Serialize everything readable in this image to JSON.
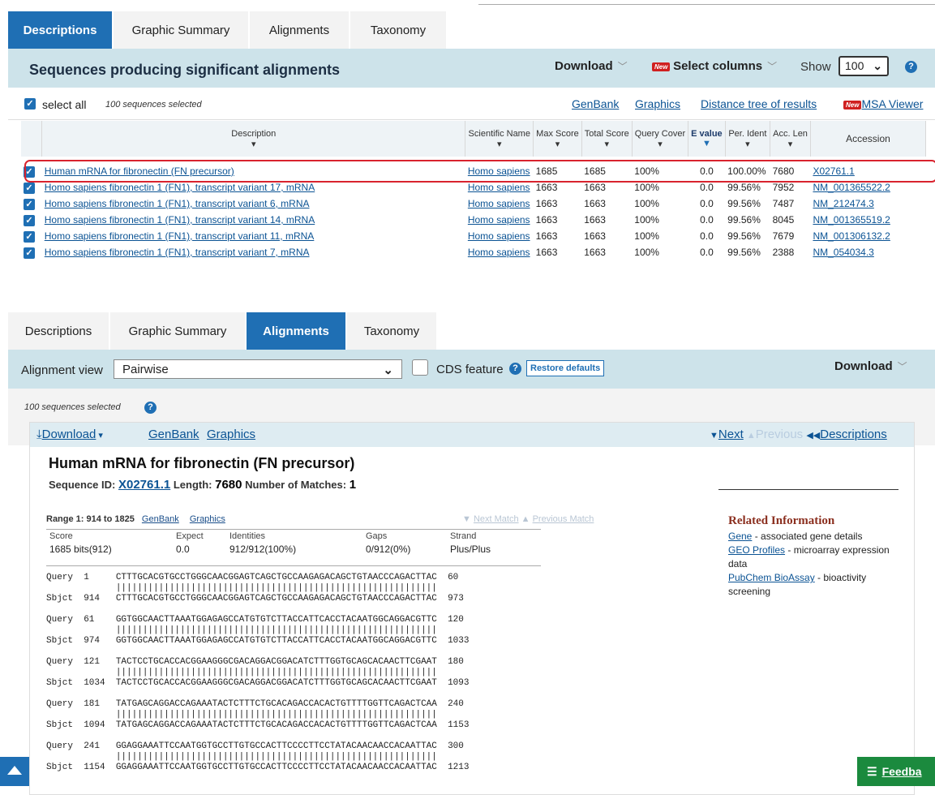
{
  "top": {
    "tabs": [
      "Descriptions",
      "Graphic Summary",
      "Alignments",
      "Taxonomy"
    ],
    "header_title": "Sequences producing significant alignments",
    "download_label": "Download",
    "new_badge": "New",
    "select_columns_label": "Select columns",
    "show_label": "Show",
    "show_value": "100",
    "select_all_label": "select all",
    "selected_count": "100 sequences selected",
    "links": [
      "GenBank",
      "Graphics",
      "Distance tree of results",
      "MSA Viewer"
    ],
    "columns": [
      "Description",
      "Scientific Name",
      "Max Score",
      "Total Score",
      "Query Cover",
      "E value",
      "Per. Ident",
      "Acc. Len",
      "Accession"
    ],
    "rows": [
      {
        "description": "Human mRNA for fibronectin (FN precursor)",
        "sci": "Homo sapiens",
        "max": "1685",
        "total": "1685",
        "cover": "100%",
        "e": "0.0",
        "ident": "100.00%",
        "len": "7680",
        "acc": "X02761.1"
      },
      {
        "description": "Homo sapiens fibronectin 1 (FN1), transcript variant 17, mRNA",
        "sci": "Homo sapiens",
        "max": "1663",
        "total": "1663",
        "cover": "100%",
        "e": "0.0",
        "ident": "99.56%",
        "len": "7952",
        "acc": "NM_001365522.2"
      },
      {
        "description": "Homo sapiens fibronectin 1 (FN1), transcript variant 6, mRNA",
        "sci": "Homo sapiens",
        "max": "1663",
        "total": "1663",
        "cover": "100%",
        "e": "0.0",
        "ident": "99.56%",
        "len": "7487",
        "acc": "NM_212474.3"
      },
      {
        "description": "Homo sapiens fibronectin 1 (FN1), transcript variant 14, mRNA",
        "sci": "Homo sapiens",
        "max": "1663",
        "total": "1663",
        "cover": "100%",
        "e": "0.0",
        "ident": "99.56%",
        "len": "8045",
        "acc": "NM_001365519.2"
      },
      {
        "description": "Homo sapiens fibronectin 1 (FN1), transcript variant 11, mRNA",
        "sci": "Homo sapiens",
        "max": "1663",
        "total": "1663",
        "cover": "100%",
        "e": "0.0",
        "ident": "99.56%",
        "len": "7679",
        "acc": "NM_001306132.2"
      },
      {
        "description": "Homo sapiens fibronectin 1 (FN1), transcript variant 7, mRNA",
        "sci": "Homo sapiens",
        "max": "1663",
        "total": "1663",
        "cover": "100%",
        "e": "0.0",
        "ident": "99.56%",
        "len": "2388",
        "acc": "NM_054034.3"
      }
    ]
  },
  "bottom": {
    "tabs": [
      "Descriptions",
      "Graphic Summary",
      "Alignments",
      "Taxonomy"
    ],
    "alignment_view_label": "Alignment view",
    "alignment_view_value": "Pairwise",
    "cds_feature_label": "CDS feature",
    "restore_defaults": "Restore defaults",
    "download_label": "Download",
    "selected_count": "100 sequences selected",
    "card": {
      "download": "Download",
      "genbank": "GenBank",
      "graphics": "Graphics",
      "next": "Next",
      "previous": "Previous",
      "descriptions": "Descriptions",
      "title": "Human mRNA for fibronectin (FN precursor)",
      "seqid_label": "Sequence ID:",
      "seqid": "X02761.1",
      "length_label": "Length:",
      "length": "7680",
      "matches_label": "Number of Matches:",
      "matches": "1",
      "range": "Range 1: 914 to 1825",
      "next_match": "Next Match",
      "previous_match": "Previous Match",
      "stats_headers": [
        "Score",
        "Expect",
        "Identities",
        "Gaps",
        "Strand"
      ],
      "stats_values": [
        "1685 bits(912)",
        "0.0",
        "912/912(100%)",
        "0/912(0%)",
        "Plus/Plus"
      ],
      "related_title": "Related Information",
      "related": [
        {
          "link": "Gene",
          "text": " - associated gene details"
        },
        {
          "link": "GEO Profiles",
          "text": " - microarray expression data"
        },
        {
          "link": "PubChem BioAssay",
          "text": " - bioactivity screening"
        }
      ],
      "alignments": [
        {
          "q": "Query  1     CTTTGCACGTGCCTGGGCAACGGAGTCAGCTGCCAAGAGACAGCTGTAACCCAGACTTAC  60",
          "m": "             ||||||||||||||||||||||||||||||||||||||||||||||||||||||||||||",
          "s": "Sbjct  914   CTTTGCACGTGCCTGGGCAACGGAGTCAGCTGCCAAGAGACAGCTGTAACCCAGACTTAC  973"
        },
        {
          "q": "Query  61    GGTGGCAACTTAAATGGAGAGCCATGTGTCTTACCATTCACCTACAATGGCAGGACGTTC  120",
          "m": "             ||||||||||||||||||||||||||||||||||||||||||||||||||||||||||||",
          "s": "Sbjct  974   GGTGGCAACTTAAATGGAGAGCCATGTGTCTTACCATTCACCTACAATGGCAGGACGTTC  1033"
        },
        {
          "q": "Query  121   TACTCCTGCACCACGGAAGGGCGACAGGACGGACATCTTTGGTGCAGCACAACTTCGAAT  180",
          "m": "             ||||||||||||||||||||||||||||||||||||||||||||||||||||||||||||",
          "s": "Sbjct  1034  TACTCCTGCACCACGGAAGGGCGACAGGACGGACATCTTTGGTGCAGCACAACTTCGAAT  1093"
        },
        {
          "q": "Query  181   TATGAGCAGGACCAGAAATACTCTTTCTGCACAGACCACACTGTTTTGGTTCAGACTCAA  240",
          "m": "             ||||||||||||||||||||||||||||||||||||||||||||||||||||||||||||",
          "s": "Sbjct  1094  TATGAGCAGGACCAGAAATACTCTTTCTGCACAGACCACACTGTTTTGGTTCAGACTCAA  1153"
        },
        {
          "q": "Query  241   GGAGGAAATTCCAATGGTGCCTTGTGCCACTTCCCCTTCCTATACAACAACCACAATTAC  300",
          "m": "             ||||||||||||||||||||||||||||||||||||||||||||||||||||||||||||",
          "s": "Sbjct  1154  GGAGGAAATTCCAATGGTGCCTTGTGCCACTTCCCCTTCCTATACAACAACCACAATTAC  1213"
        }
      ]
    },
    "feedback": "Feedba"
  }
}
